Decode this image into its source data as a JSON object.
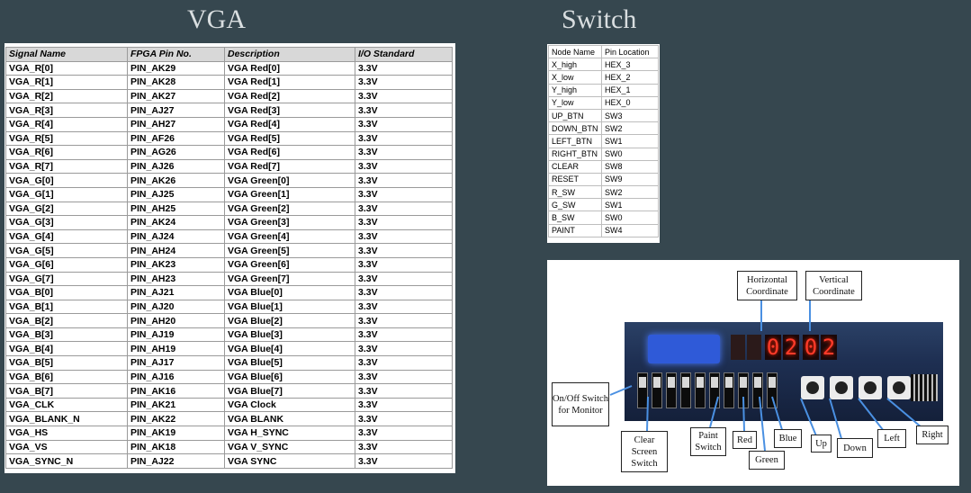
{
  "titles": {
    "vga": "VGA",
    "switch": "Switch"
  },
  "vga_table": {
    "headers": [
      "Signal Name",
      "FPGA Pin No.",
      "Description",
      "I/O Standard"
    ],
    "rows": [
      [
        "VGA_R[0]",
        "PIN_AK29",
        "VGA Red[0]",
        "3.3V"
      ],
      [
        "VGA_R[1]",
        "PIN_AK28",
        "VGA Red[1]",
        "3.3V"
      ],
      [
        "VGA_R[2]",
        "PIN_AK27",
        "VGA Red[2]",
        "3.3V"
      ],
      [
        "VGA_R[3]",
        "PIN_AJ27",
        "VGA Red[3]",
        "3.3V"
      ],
      [
        "VGA_R[4]",
        "PIN_AH27",
        "VGA Red[4]",
        "3.3V"
      ],
      [
        "VGA_R[5]",
        "PIN_AF26",
        "VGA Red[5]",
        "3.3V"
      ],
      [
        "VGA_R[6]",
        "PIN_AG26",
        "VGA Red[6]",
        "3.3V"
      ],
      [
        "VGA_R[7]",
        "PIN_AJ26",
        "VGA Red[7]",
        "3.3V"
      ],
      [
        "VGA_G[0]",
        "PIN_AK26",
        "VGA Green[0]",
        "3.3V"
      ],
      [
        "VGA_G[1]",
        "PIN_AJ25",
        "VGA Green[1]",
        "3.3V"
      ],
      [
        "VGA_G[2]",
        "PIN_AH25",
        "VGA Green[2]",
        "3.3V"
      ],
      [
        "VGA_G[3]",
        "PIN_AK24",
        "VGA Green[3]",
        "3.3V"
      ],
      [
        "VGA_G[4]",
        "PIN_AJ24",
        "VGA Green[4]",
        "3.3V"
      ],
      [
        "VGA_G[5]",
        "PIN_AH24",
        "VGA Green[5]",
        "3.3V"
      ],
      [
        "VGA_G[6]",
        "PIN_AK23",
        "VGA Green[6]",
        "3.3V"
      ],
      [
        "VGA_G[7]",
        "PIN_AH23",
        "VGA Green[7]",
        "3.3V"
      ],
      [
        "VGA_B[0]",
        "PIN_AJ21",
        "VGA Blue[0]",
        "3.3V"
      ],
      [
        "VGA_B[1]",
        "PIN_AJ20",
        "VGA Blue[1]",
        "3.3V"
      ],
      [
        "VGA_B[2]",
        "PIN_AH20",
        "VGA Blue[2]",
        "3.3V"
      ],
      [
        "VGA_B[3]",
        "PIN_AJ19",
        "VGA Blue[3]",
        "3.3V"
      ],
      [
        "VGA_B[4]",
        "PIN_AH19",
        "VGA Blue[4]",
        "3.3V"
      ],
      [
        "VGA_B[5]",
        "PIN_AJ17",
        "VGA Blue[5]",
        "3.3V"
      ],
      [
        "VGA_B[6]",
        "PIN_AJ16",
        "VGA Blue[6]",
        "3.3V"
      ],
      [
        "VGA_B[7]",
        "PIN_AK16",
        "VGA Blue[7]",
        "3.3V"
      ],
      [
        "VGA_CLK",
        "PIN_AK21",
        "VGA Clock",
        "3.3V"
      ],
      [
        "VGA_BLANK_N",
        "PIN_AK22",
        "VGA BLANK",
        "3.3V"
      ],
      [
        "VGA_HS",
        "PIN_AK19",
        "VGA H_SYNC",
        "3.3V"
      ],
      [
        "VGA_VS",
        "PIN_AK18",
        "VGA V_SYNC",
        "3.3V"
      ],
      [
        "VGA_SYNC_N",
        "PIN_AJ22",
        "VGA SYNC",
        "3.3V"
      ]
    ]
  },
  "switch_table": {
    "rows": [
      [
        "Node Name",
        "Pin Location"
      ],
      [
        "X_high",
        "HEX_3"
      ],
      [
        "X_low",
        "HEX_2"
      ],
      [
        "Y_high",
        "HEX_1"
      ],
      [
        "Y_low",
        "HEX_0"
      ],
      [
        "UP_BTN",
        "SW3"
      ],
      [
        "DOWN_BTN",
        "SW2"
      ],
      [
        "LEFT_BTN",
        "SW1"
      ],
      [
        "RIGHT_BTN",
        "SW0"
      ],
      [
        "CLEAR",
        "SW8"
      ],
      [
        "RESET",
        "SW9"
      ],
      [
        "R_SW",
        "SW2"
      ],
      [
        "G_SW",
        "SW1"
      ],
      [
        "B_SW",
        "SW0"
      ],
      [
        "PAINT",
        "SW4"
      ]
    ]
  },
  "board": {
    "display_digits": [
      "0",
      "2",
      "0",
      "2"
    ],
    "labels": {
      "horizontal": "Horizontal Coordinate",
      "vertical": "Vertical Coordinate",
      "onoff": "On/Off Switch for Monitor",
      "clear": "Clear Screen Switch",
      "paint": "Paint Switch",
      "red": "Red",
      "blue": "Blue",
      "green": "Green",
      "up": "Up",
      "down": "Down",
      "left": "Left",
      "right": "Right"
    }
  }
}
